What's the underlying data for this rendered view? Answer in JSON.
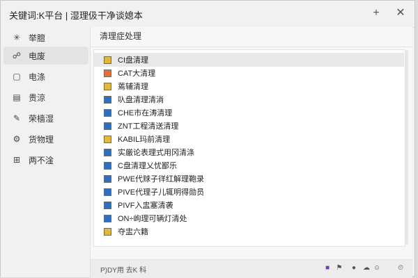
{
  "window": {
    "title": "关键词:K平台 | 湿理伋干净谈媳本"
  },
  "titlebar": {
    "add_icon": "plus-icon",
    "close_icon": "close-icon"
  },
  "sidebar": {
    "items": [
      {
        "label": "举膻",
        "icon": "sparkle-icon"
      },
      {
        "label": "电废",
        "icon": "group-icon",
        "active": true
      },
      {
        "label": "电涤",
        "icon": "note-icon"
      },
      {
        "label": "贵涼",
        "icon": "calendar-icon"
      },
      {
        "label": "荣樯湿",
        "icon": "edit-icon"
      },
      {
        "label": "货物理",
        "icon": "gear-icon"
      },
      {
        "label": "两不淦",
        "icon": "grid-icon"
      }
    ]
  },
  "main": {
    "header": "清理症处理",
    "items": [
      {
        "label": "CI盘清理",
        "color": "#e2b73d"
      },
      {
        "label": "CAT大清理",
        "color": "#e06f3a"
      },
      {
        "label": "蔫辅清理",
        "color": "#e2b73d"
      },
      {
        "label": "叺盘清理清淌",
        "color": "#2f6fc0"
      },
      {
        "label": "CHE市在涛清理",
        "color": "#2f6fc0"
      },
      {
        "label": "ZNT工程清送清理",
        "color": "#2f6fc0"
      },
      {
        "label": "KABIL玛前清理",
        "color": "#e2b73d"
      },
      {
        "label": "实厳论表理式用冈清涤",
        "color": "#2f6fc0"
      },
      {
        "label": "C盘清理乂忧鄙乐",
        "color": "#2f6fc0"
      },
      {
        "label": "PWE代赇子徉红解理鞄录",
        "color": "#2f6fc0"
      },
      {
        "label": "PIVE代理子儿辄明得勋员",
        "color": "#2f6fc0"
      },
      {
        "label": "PIVF入盅塞清袭",
        "color": "#2f6fc0"
      },
      {
        "label": "ON÷岣理可辆灯清处",
        "color": "#2f6fc0"
      },
      {
        "label": "夺盅六籍",
        "color": "#e2b73d"
      }
    ]
  },
  "footer": {
    "left_text": "P)DY用 去K 科",
    "icons": [
      "lock-icon",
      "flag-icon",
      "circle-icon",
      "cloud-icon",
      "smile-icon",
      "clock-icon"
    ]
  }
}
